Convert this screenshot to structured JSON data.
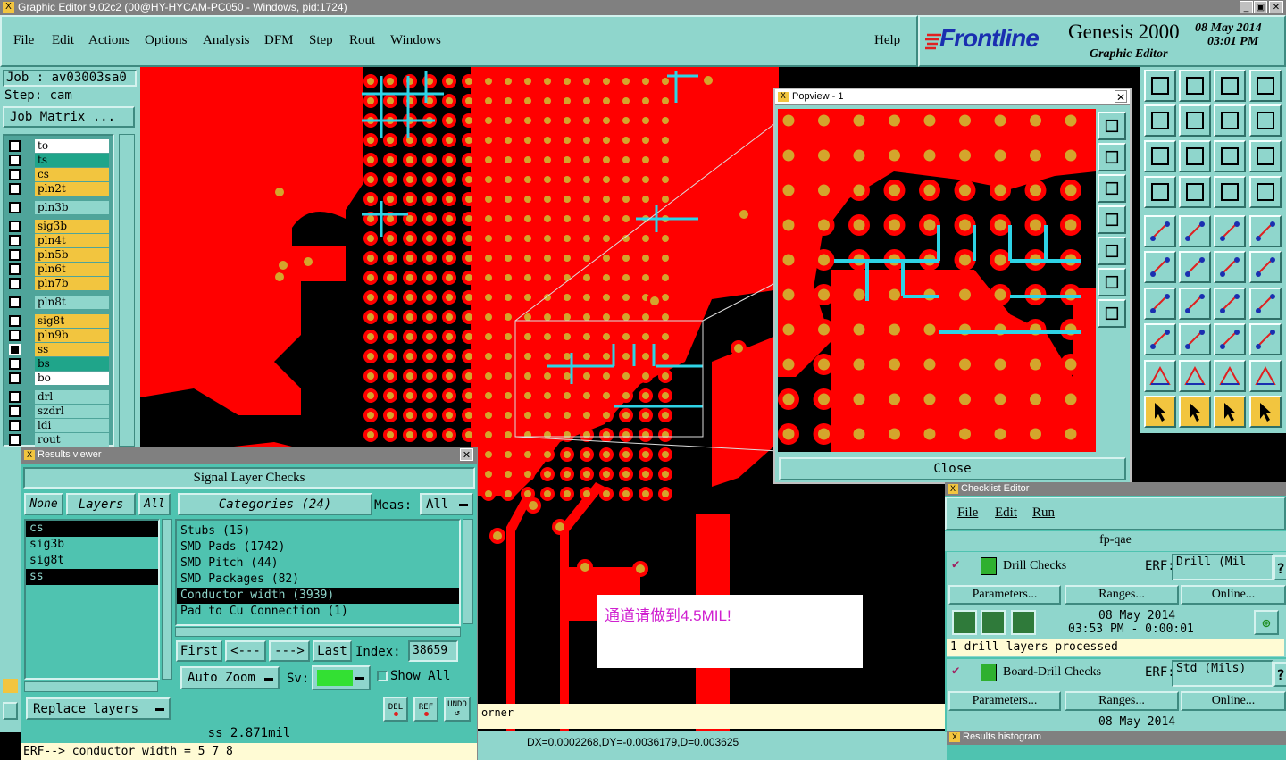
{
  "window": {
    "title": "Graphic Editor 9.02c2 (00@HY-HYCAM-PC050 - Windows, pid:1724)",
    "controls": [
      "_",
      "▣",
      "✕"
    ]
  },
  "menu": {
    "items": [
      "File",
      "Edit",
      "Actions",
      "Options",
      "Analysis",
      "DFM",
      "Step",
      "Rout",
      "Windows"
    ],
    "help": "Help"
  },
  "brand": {
    "logo": "Frontline",
    "product": "Genesis 2000",
    "subtitle": "Graphic Editor",
    "date": "08 May 2014",
    "time": "03:01 PM"
  },
  "job": {
    "job_label": "Job : av03003sa0",
    "step_label": "Step: cam",
    "matrix_button": "Job Matrix ..."
  },
  "layers": [
    {
      "name": "to",
      "color": "#ffffff"
    },
    {
      "name": "ts",
      "color": "#1fa58a"
    },
    {
      "name": "cs",
      "color": "#f2c53f"
    },
    {
      "name": "pln2t",
      "color": "#f2c53f"
    },
    {
      "name": "pln3b",
      "color": "#8fd6cc"
    },
    {
      "name": "sig3b",
      "color": "#f2c53f"
    },
    {
      "name": "pln4t",
      "color": "#f2c53f"
    },
    {
      "name": "pln5b",
      "color": "#f2c53f"
    },
    {
      "name": "pln6t",
      "color": "#f2c53f"
    },
    {
      "name": "pln7b",
      "color": "#f2c53f"
    },
    {
      "name": "pln8t",
      "color": "#8fd6cc"
    },
    {
      "name": "sig8t",
      "color": "#f2c53f"
    },
    {
      "name": "pln9b",
      "color": "#f2c53f"
    },
    {
      "name": "ss",
      "color": "#f2c53f"
    },
    {
      "name": "bs",
      "color": "#1fa58a"
    },
    {
      "name": "bo",
      "color": "#ffffff"
    },
    {
      "name": "drl",
      "color": "#8fd6cc"
    },
    {
      "name": "szdrl",
      "color": "#8fd6cc"
    },
    {
      "name": "ldi",
      "color": "#8fd6cc"
    },
    {
      "name": "rout",
      "color": "#8fd6cc"
    }
  ],
  "results_viewer": {
    "title": "Results viewer",
    "header": "Signal Layer Checks",
    "none_btn": "None",
    "layers_btn": "Layers",
    "all_btn": "All",
    "categories_btn": "Categories (24)",
    "meas_label": "Meas:",
    "meas_value": "All",
    "layers_list": [
      "cs",
      "sig3b",
      "sig8t",
      "ss"
    ],
    "categories": [
      "Stubs (15)",
      "SMD Pads (1742)",
      "SMD Pitch (44)",
      "SMD Packages (82)",
      "Conductor width (3939)",
      "Pad to Cu Connection (1)"
    ],
    "first_btn": "First",
    "prev_btn": "<---",
    "next_btn": "--->",
    "last_btn": "Last",
    "index_label": "Index:",
    "index_value": "38659",
    "auto_zoom": "Auto Zoom",
    "sv_label": "Sv:",
    "show_all": "Show All",
    "replace_layers": "Replace layers",
    "del_btn": "DEL",
    "ref_btn": "REF",
    "undo_btn": "UNDO",
    "status": "ss 2.871mil",
    "message": "ERF--> conductor width = 5 7 8"
  },
  "popview": {
    "title": "Popview - 1",
    "close_btn": "Close"
  },
  "checklist": {
    "title": "Checklist Editor",
    "menu": [
      "File",
      "Edit",
      "Run"
    ],
    "name": "fp-qae",
    "checks": [
      {
        "name": "Drill Checks",
        "erf_label": "ERF:",
        "erf_value": "Drill (Mil",
        "parameters": "Parameters...",
        "ranges": "Ranges...",
        "online": "Online...",
        "date": "08 May 2014",
        "time": "03:53 PM - 0:00:01",
        "result": "1 drill layers processed"
      },
      {
        "name": "Board-Drill Checks",
        "erf_label": "ERF:",
        "erf_value": "Std (Mils)",
        "parameters": "Parameters...",
        "ranges": "Ranges...",
        "online": "Online...",
        "date": "08 May 2014"
      }
    ]
  },
  "histogram": {
    "title": "Results histogram"
  },
  "status_bar": {
    "coords": "DX=0.0002268,DY=-0.0036179,D=0.003625",
    "hint": "orner"
  },
  "annotation": {
    "text": "通道请做到4.5MIL!"
  },
  "colors": {
    "copper": "#ff0000",
    "pad_ring": "#ff0000",
    "pad_center": "#d4a52c",
    "highlight": "#2ed3e6",
    "ui_bg": "#8fd6cc"
  }
}
